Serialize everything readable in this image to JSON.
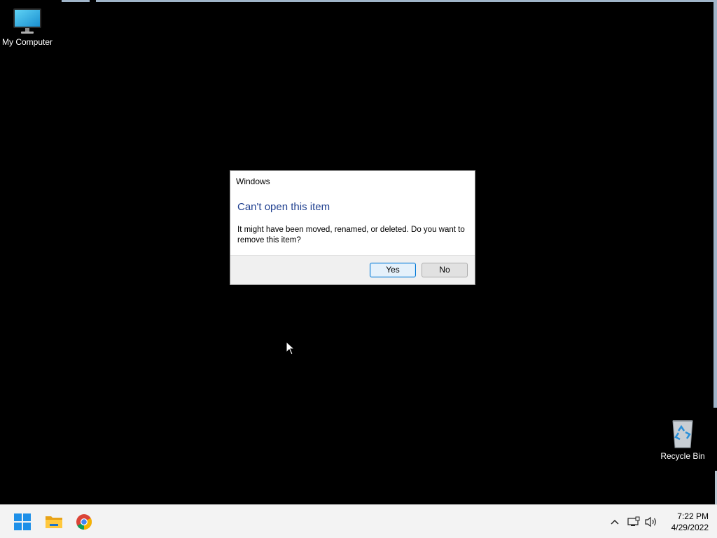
{
  "desktop": {
    "icons": [
      {
        "label": "My Computer",
        "icon": "monitor-icon"
      },
      {
        "label": "Recycle Bin",
        "icon": "recycle-bin-icon"
      }
    ]
  },
  "dialog": {
    "title": "Windows",
    "heading": "Can't open this item",
    "message": "It might have been moved, renamed, or deleted. Do you want to remove this item?",
    "yes_label": "Yes",
    "no_label": "No",
    "heading_color": "#1f3f8f"
  },
  "taskbar": {
    "apps": [
      {
        "icon": "windows-start-icon"
      },
      {
        "icon": "file-explorer-icon"
      },
      {
        "icon": "chrome-icon"
      }
    ],
    "tray": {
      "icons": [
        "chevron-up-icon",
        "network-icon",
        "volume-icon"
      ],
      "time": "7:22 PM",
      "date": "4/29/2022"
    }
  },
  "colors": {
    "accent": "#0078d7",
    "taskbar_bg": "#f3f3f3",
    "desktop_bg": "#000000"
  }
}
